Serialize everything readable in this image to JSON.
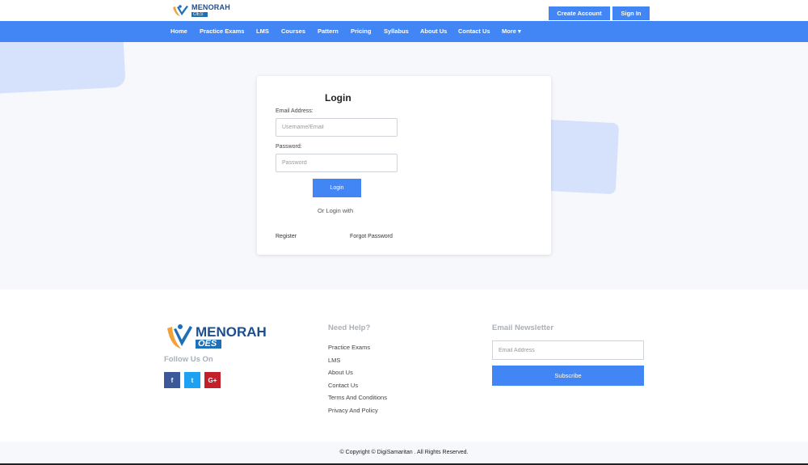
{
  "header": {
    "logo": {
      "brand": "MENORAH",
      "sub": "OES"
    },
    "create_account_label": "Create Account",
    "sign_in_label": "Sign In"
  },
  "nav": {
    "items": [
      "Home",
      "Practice Exams",
      "LMS",
      "Courses",
      "Pattern",
      "Pricing",
      "Syllabus",
      "About Us",
      "Contact Us",
      "More ▾"
    ]
  },
  "login": {
    "title": "Login",
    "email_label": "Email Address:",
    "email_placeholder": "Username/Email",
    "password_label": "Password:",
    "password_placeholder": "Password",
    "login_button": "Login",
    "or_login_with": "Or Login with",
    "register_link": "Register",
    "forgot_link": "Forgot Password"
  },
  "footer": {
    "logo": {
      "brand": "MENORAH",
      "sub": "OES"
    },
    "follow_title": "Follow Us On",
    "social": [
      {
        "icon": "facebook-icon",
        "glyph": "f"
      },
      {
        "icon": "twitter-icon",
        "glyph": "t"
      },
      {
        "icon": "google-plus-icon",
        "glyph": "G+"
      }
    ],
    "help_title": "Need Help?",
    "help_links": [
      "Practice Exams",
      "LMS",
      "About Us",
      "Contact Us",
      "Terms And Conditions",
      "Privacy And Policy"
    ],
    "newsletter_title": "Email Newsletter",
    "newsletter_placeholder": "Email Address",
    "subscribe_label": "Subscribe",
    "copyright": "© Copyright © DigiSamaritan . All Rights Reserved."
  },
  "colors": {
    "accent": "#4285f4",
    "hero_bg": "#f7f8fc",
    "blob": "#d6e2fb",
    "brand_dark": "#1d4e8f",
    "facebook": "#3b5998",
    "twitter": "#1da1f2",
    "google_plus": "#c4202b"
  }
}
